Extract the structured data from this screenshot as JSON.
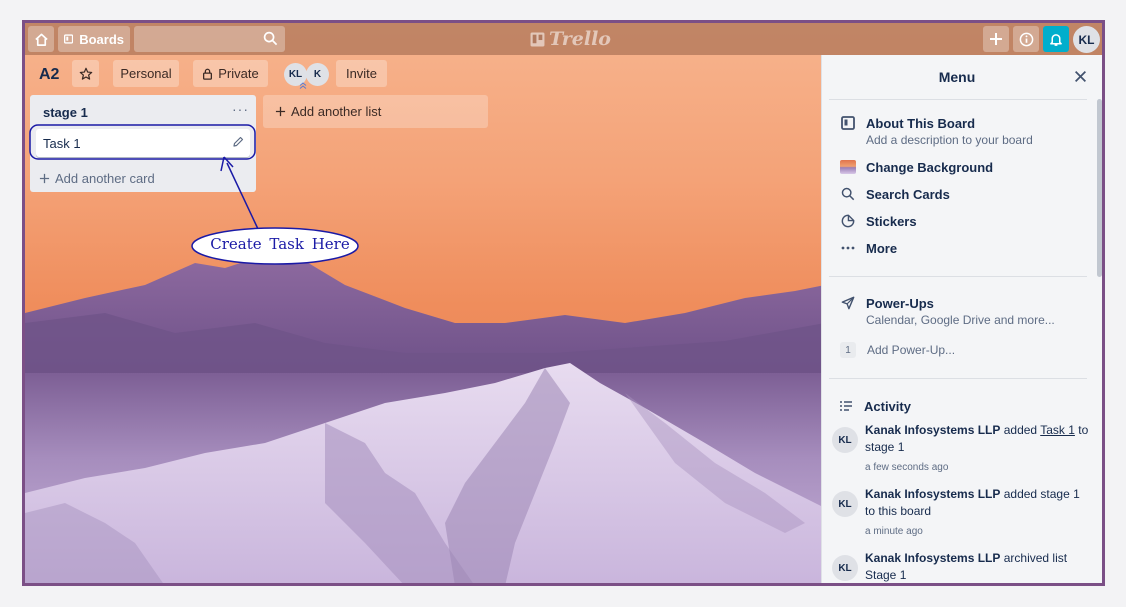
{
  "topbar": {
    "boards_label": "Boards",
    "search_placeholder": "",
    "logo_text": "Trello",
    "user_initials": "KL"
  },
  "board": {
    "title": "A2",
    "personal_label": "Personal",
    "private_label": "Private",
    "members": [
      "KL",
      "K"
    ],
    "invite_label": "Invite"
  },
  "lists": [
    {
      "title": "stage 1",
      "menu_glyph": "···",
      "cards": [
        {
          "title": "Task 1"
        }
      ],
      "add_card_label": "Add another card"
    }
  ],
  "add_list_label": "Add another list",
  "annotation": {
    "label": "Create Task Here",
    "color": "#1a1aa6"
  },
  "menu": {
    "title": "Menu",
    "items": [
      {
        "label": "About This Board",
        "sub": "Add a description to your board",
        "icon": "board-icon"
      },
      {
        "label": "Change Background",
        "icon": "background-thumb"
      },
      {
        "label": "Search Cards",
        "icon": "search-icon"
      },
      {
        "label": "Stickers",
        "icon": "sticker-icon"
      },
      {
        "label": "More",
        "icon": "more-icon"
      }
    ],
    "powerups": {
      "label": "Power-Ups",
      "sub": "Calendar, Google Drive and more...",
      "add_count": "1",
      "add_label": "Add Power-Up..."
    },
    "activity_title": "Activity",
    "activity": [
      {
        "initials": "KL",
        "user": "Kanak Infosystems LLP",
        "action": "added",
        "link": "Task 1",
        "rest": "to stage 1",
        "time": "a few seconds ago"
      },
      {
        "initials": "KL",
        "user": "Kanak Infosystems LLP",
        "action": "added stage 1 to this board",
        "time": "a minute ago"
      },
      {
        "initials": "KL",
        "user": "Kanak Infosystems LLP",
        "action": "archived list Stage 1"
      }
    ]
  },
  "colors": {
    "frame": "#7b4f86",
    "bell": "#00aecc",
    "annotation": "#1a1aa6"
  }
}
